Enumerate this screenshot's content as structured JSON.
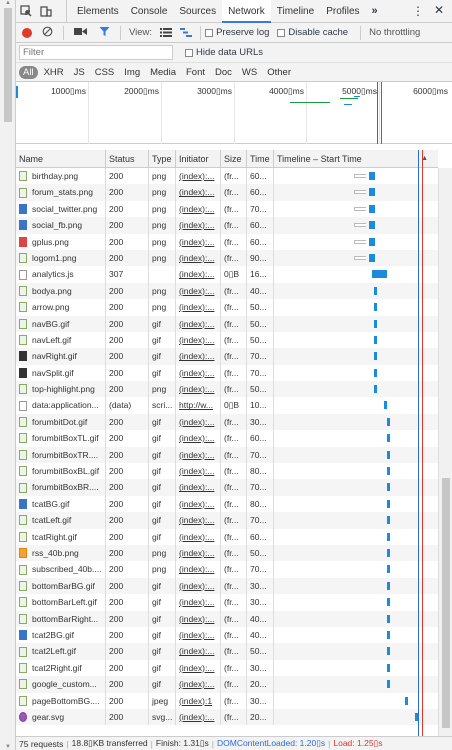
{
  "tabs": [
    "Elements",
    "Console",
    "Sources",
    "Network",
    "Timeline",
    "Profiles"
  ],
  "active_tab": "Network",
  "more_tabs": "»",
  "toolbar": {
    "view_label": "View:",
    "preserve_log": "Preserve log",
    "disable_cache": "Disable cache",
    "throttling": "No throttling"
  },
  "filter": {
    "placeholder": "Filter",
    "hide_data_urls": "Hide data URLs"
  },
  "types": [
    "All",
    "XHR",
    "JS",
    "CSS",
    "Img",
    "Media",
    "Font",
    "Doc",
    "WS",
    "Other"
  ],
  "overview_ticks": [
    "1000▯ms",
    "2000▯ms",
    "3000▯ms",
    "4000▯ms",
    "5000▯ms",
    "6000▯ms"
  ],
  "columns": {
    "name": "Name",
    "status": "Status",
    "type": "Type",
    "initiator": "Initiator",
    "size": "Size",
    "time": "Time",
    "timeline": "Timeline – Start Time"
  },
  "rows": [
    {
      "name": "birthday.png",
      "status": "200",
      "type": "png",
      "init": "(index):...",
      "size": "(fr...",
      "time": "60...",
      "icon": "img",
      "ws": 0.56,
      "wr": 0.035,
      "we": 0.58
    },
    {
      "name": "forum_stats.png",
      "status": "200",
      "type": "png",
      "init": "(index):...",
      "size": "(fr...",
      "time": "60...",
      "icon": "img",
      "ws": 0.56,
      "wr": 0.035,
      "we": 0.58
    },
    {
      "name": "social_twitter.png",
      "status": "200",
      "type": "png",
      "init": "(index):...",
      "size": "(fr...",
      "time": "70...",
      "icon": "blue",
      "ws": 0.56,
      "wr": 0.035,
      "we": 0.58
    },
    {
      "name": "social_fb.png",
      "status": "200",
      "type": "png",
      "init": "(index):...",
      "size": "(fr...",
      "time": "60...",
      "icon": "blue",
      "ws": 0.56,
      "wr": 0.035,
      "we": 0.58
    },
    {
      "name": "gplus.png",
      "status": "200",
      "type": "png",
      "init": "(index):...",
      "size": "(fr...",
      "time": "60...",
      "icon": "red",
      "ws": 0.56,
      "wr": 0.035,
      "we": 0.58
    },
    {
      "name": "logom1.png",
      "status": "200",
      "type": "png",
      "init": "(index):...",
      "size": "(fr...",
      "time": "90...",
      "icon": "img",
      "ws": 0.56,
      "wr": 0.035,
      "we": 0.58
    },
    {
      "name": "analytics.js",
      "status": "307",
      "type": "",
      "init": "(index):...",
      "size": "0▯B",
      "time": "16...",
      "icon": "js",
      "ws": 0.6,
      "wr": 0.09,
      "we": 0.6
    },
    {
      "name": "bodya.png",
      "status": "200",
      "type": "png",
      "init": "(index):...",
      "size": "(fr...",
      "time": "40...",
      "icon": "img",
      "ws": 0.61,
      "wr": 0.02,
      "we": 0.61
    },
    {
      "name": "arrow.png",
      "status": "200",
      "type": "png",
      "init": "(index):...",
      "size": "(fr...",
      "time": "50...",
      "icon": "img",
      "ws": 0.61,
      "wr": 0.02,
      "we": 0.61
    },
    {
      "name": "navBG.gif",
      "status": "200",
      "type": "gif",
      "init": "(index):...",
      "size": "(fr...",
      "time": "50...",
      "icon": "img",
      "ws": 0.61,
      "wr": 0.02,
      "we": 0.61
    },
    {
      "name": "navLeft.gif",
      "status": "200",
      "type": "gif",
      "init": "(index):...",
      "size": "(fr...",
      "time": "50...",
      "icon": "img",
      "ws": 0.61,
      "wr": 0.02,
      "we": 0.61
    },
    {
      "name": "navRight.gif",
      "status": "200",
      "type": "gif",
      "init": "(index):...",
      "size": "(fr...",
      "time": "70...",
      "icon": "dark",
      "ws": 0.61,
      "wr": 0.02,
      "we": 0.61
    },
    {
      "name": "navSplit.gif",
      "status": "200",
      "type": "gif",
      "init": "(index):...",
      "size": "(fr...",
      "time": "70...",
      "icon": "dark",
      "ws": 0.61,
      "wr": 0.02,
      "we": 0.61
    },
    {
      "name": "top-highlight.png",
      "status": "200",
      "type": "png",
      "init": "(index):...",
      "size": "(fr...",
      "time": "50...",
      "icon": "img",
      "ws": 0.61,
      "wr": 0.02,
      "we": 0.61
    },
    {
      "name": "data:application...",
      "status": "(data)",
      "type": "scri...",
      "init": "http://w...",
      "size": "0▯B",
      "time": "10...",
      "icon": "js",
      "ws": 0.67,
      "wr": 0.02,
      "we": 0.67
    },
    {
      "name": "forumbitDot.gif",
      "status": "200",
      "type": "gif",
      "init": "(index):...",
      "size": "(fr...",
      "time": "30...",
      "icon": "img",
      "ws": 0.69,
      "wr": 0.02,
      "we": 0.69
    },
    {
      "name": "forumbitBoxTL.gif",
      "status": "200",
      "type": "gif",
      "init": "(index):...",
      "size": "(fr...",
      "time": "60...",
      "icon": "img",
      "ws": 0.69,
      "wr": 0.02,
      "we": 0.69
    },
    {
      "name": "forumbitBoxTR....",
      "status": "200",
      "type": "gif",
      "init": "(index):...",
      "size": "(fr...",
      "time": "70...",
      "icon": "img",
      "ws": 0.69,
      "wr": 0.02,
      "we": 0.69
    },
    {
      "name": "forumbitBoxBL.gif",
      "status": "200",
      "type": "gif",
      "init": "(index):...",
      "size": "(fr...",
      "time": "80...",
      "icon": "img",
      "ws": 0.69,
      "wr": 0.02,
      "we": 0.69
    },
    {
      "name": "forumbitBoxBR....",
      "status": "200",
      "type": "gif",
      "init": "(index):...",
      "size": "(fr...",
      "time": "70...",
      "icon": "img",
      "ws": 0.69,
      "wr": 0.02,
      "we": 0.69
    },
    {
      "name": "tcatBG.gif",
      "status": "200",
      "type": "gif",
      "init": "(index):...",
      "size": "(fr...",
      "time": "80...",
      "icon": "blue",
      "ws": 0.69,
      "wr": 0.02,
      "we": 0.69
    },
    {
      "name": "tcatLeft.gif",
      "status": "200",
      "type": "gif",
      "init": "(index):...",
      "size": "(fr...",
      "time": "70...",
      "icon": "img",
      "ws": 0.69,
      "wr": 0.02,
      "we": 0.69
    },
    {
      "name": "tcatRight.gif",
      "status": "200",
      "type": "gif",
      "init": "(index):...",
      "size": "(fr...",
      "time": "60...",
      "icon": "img",
      "ws": 0.69,
      "wr": 0.02,
      "we": 0.69
    },
    {
      "name": "rss_40b.png",
      "status": "200",
      "type": "png",
      "init": "(index):...",
      "size": "(fr...",
      "time": "50...",
      "icon": "orange",
      "ws": 0.69,
      "wr": 0.02,
      "we": 0.69
    },
    {
      "name": "subscribed_40b....",
      "status": "200",
      "type": "png",
      "init": "(index):...",
      "size": "(fr...",
      "time": "70...",
      "icon": "img",
      "ws": 0.69,
      "wr": 0.02,
      "we": 0.69
    },
    {
      "name": "bottomBarBG.gif",
      "status": "200",
      "type": "gif",
      "init": "(index):...",
      "size": "(fr...",
      "time": "30...",
      "icon": "img",
      "ws": 0.69,
      "wr": 0.02,
      "we": 0.69
    },
    {
      "name": "bottomBarLeft.gif",
      "status": "200",
      "type": "gif",
      "init": "(index):...",
      "size": "(fr...",
      "time": "30...",
      "icon": "img",
      "ws": 0.69,
      "wr": 0.02,
      "we": 0.69
    },
    {
      "name": "bottomBarRight...",
      "status": "200",
      "type": "gif",
      "init": "(index):...",
      "size": "(fr...",
      "time": "40...",
      "icon": "img",
      "ws": 0.69,
      "wr": 0.02,
      "we": 0.69
    },
    {
      "name": "tcat2BG.gif",
      "status": "200",
      "type": "gif",
      "init": "(index):...",
      "size": "(fr...",
      "time": "40...",
      "icon": "blue",
      "ws": 0.69,
      "wr": 0.02,
      "we": 0.69
    },
    {
      "name": "tcat2Left.gif",
      "status": "200",
      "type": "gif",
      "init": "(index):...",
      "size": "(fr...",
      "time": "50...",
      "icon": "img",
      "ws": 0.69,
      "wr": 0.02,
      "we": 0.69
    },
    {
      "name": "tcat2Right.gif",
      "status": "200",
      "type": "gif",
      "init": "(index):...",
      "size": "(fr...",
      "time": "30...",
      "icon": "img",
      "ws": 0.69,
      "wr": 0.02,
      "we": 0.69
    },
    {
      "name": "google_custom...",
      "status": "200",
      "type": "gif",
      "init": "(index):...",
      "size": "(fr...",
      "time": "20...",
      "icon": "img",
      "ws": 0.69,
      "wr": 0.02,
      "we": 0.69
    },
    {
      "name": "pageBottomBG....",
      "status": "200",
      "type": "jpeg",
      "init": "(index):1",
      "size": "(fr...",
      "time": "30...",
      "icon": "img",
      "ws": 0.8,
      "wr": 0.02,
      "we": 0.8
    },
    {
      "name": "gear.svg",
      "status": "200",
      "type": "svg...",
      "init": "(index):...",
      "size": "(fr...",
      "time": "20...",
      "icon": "svg",
      "ws": 0.86,
      "wr": 0.02,
      "we": 0.86
    }
  ],
  "status": {
    "requests": "75 requests",
    "transferred": "18.8▯KB transferred",
    "finish": "Finish: 1.31▯s",
    "dcl": "DOMContentLoaded: 1.20▯s",
    "load": "Load: 1.25▯s"
  },
  "colors": {
    "dcl": "#2b6bd8",
    "load": "#e0352b",
    "accent": "#3879d9",
    "record": "#e03a2b"
  }
}
